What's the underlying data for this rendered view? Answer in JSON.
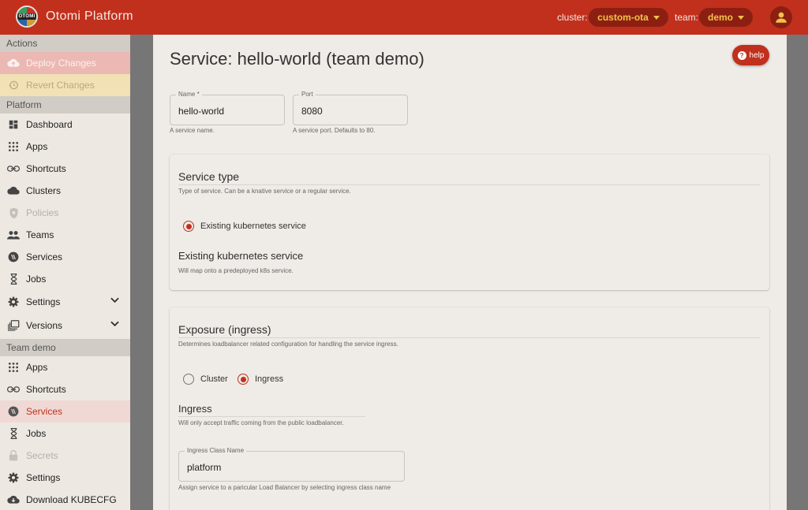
{
  "header": {
    "logo_text": "OTOMI",
    "brand": "Otomi Platform",
    "cluster_label": "cluster:",
    "cluster_value": "custom-ota",
    "team_label": "team:",
    "team_value": "demo",
    "user_icon": "account-icon"
  },
  "sidebar": {
    "actions_header": "Actions",
    "deploy": "Deploy Changes",
    "revert": "Revert Changes",
    "platform_header": "Platform",
    "platform_items": [
      {
        "label": "Dashboard",
        "icon": "dashboard-icon"
      },
      {
        "label": "Apps",
        "icon": "apps-grid-icon"
      },
      {
        "label": "Shortcuts",
        "icon": "link-icon"
      },
      {
        "label": "Clusters",
        "icon": "cloud-icon"
      },
      {
        "label": "Policies",
        "icon": "shield-icon"
      },
      {
        "label": "Teams",
        "icon": "people-icon"
      },
      {
        "label": "Services",
        "icon": "services-icon"
      },
      {
        "label": "Jobs",
        "icon": "hourglass-icon"
      },
      {
        "label": "Settings",
        "icon": "gear-icon"
      },
      {
        "label": "Versions",
        "icon": "versions-icon"
      }
    ],
    "team_header": "Team demo",
    "team_items": [
      {
        "label": "Apps",
        "icon": "apps-grid-icon"
      },
      {
        "label": "Shortcuts",
        "icon": "link-icon"
      },
      {
        "label": "Services",
        "icon": "services-icon"
      },
      {
        "label": "Jobs",
        "icon": "hourglass-icon"
      },
      {
        "label": "Secrets",
        "icon": "lock-icon"
      },
      {
        "label": "Settings",
        "icon": "gear-icon"
      },
      {
        "label": "Download KUBECFG",
        "icon": "cloud-download-icon"
      }
    ]
  },
  "main": {
    "title": "Service: hello-world (team demo)",
    "help_label": "help",
    "name_field": {
      "label": "Name *",
      "value": "hello-world",
      "helper": "A service name."
    },
    "port_field": {
      "label": "Port",
      "value": "8080",
      "helper": "A service port. Defaults to 80."
    },
    "service_type": {
      "title": "Service type",
      "desc": "Type of service. Can be a knative service or a regular service.",
      "option": "Existing kubernetes service",
      "sub_title": "Existing kubernetes service",
      "sub_desc": "Will map onto a predeployed k8s service."
    },
    "exposure": {
      "title": "Exposure (ingress)",
      "desc": "Determines loadbalancer related configuration for handling the service ingress.",
      "option_cluster": "Cluster",
      "option_ingress": "Ingress",
      "selected": "Ingress",
      "sub_title": "Ingress",
      "sub_desc": "Will only accept traffic coming from the public loadbalancer.",
      "class_field": {
        "label": "Ingress Class Name",
        "value": "platform",
        "helper": "Assign service to a paricular Load Balancer by selecting ingress class name"
      }
    }
  },
  "colors": {
    "primary": "#c1301d",
    "accent_text": "#f3c24a",
    "pill_bg": "#8c1f12"
  }
}
